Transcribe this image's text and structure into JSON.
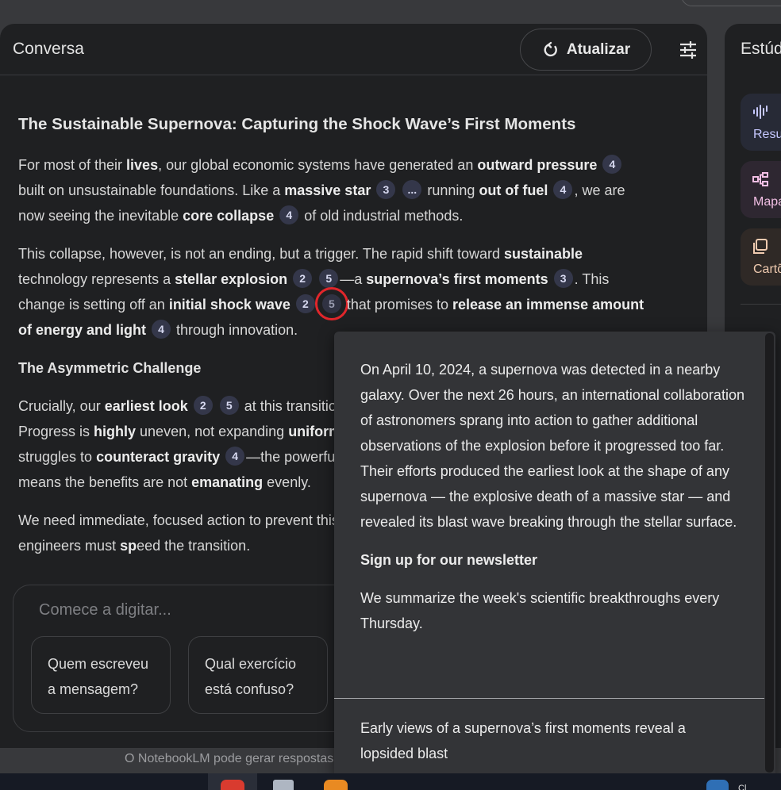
{
  "chat": {
    "title": "Conversa",
    "refresh_label": "Atualizar",
    "heading": "The Sustainable Supernova: Capturing the Shock Wave’s First Moments",
    "subhead": "The Asymmetric Challenge",
    "input_placeholder": "Comece a digitar...",
    "suggestions": [
      "Quem escreveu a mensagem?",
      "Qual exercício está confuso?"
    ],
    "footer_note": "O NotebookLM pode gerar respostas"
  },
  "studio": {
    "title": "Estúdio",
    "tiles": [
      {
        "label": "Resumo",
        "color": "#c6c8ff",
        "bg": "#272a36"
      },
      {
        "label": "Mapa mental",
        "color": "#f2bfe4",
        "bg": "#2e2731"
      },
      {
        "label": "Cartões",
        "color": "#f0cbb0",
        "bg": "#2f2926"
      }
    ]
  },
  "popover": {
    "paragraph": "On April 10, 2024, a supernova was detected in a nearby galaxy. Over the next 26 hours, an international collaboration of astronomers sprang into action to gather additional observations of the explosion before it progressed too far. Their efforts produced the earliest look at the shape of any supernova — the explosive death of a massive star — and revealed its blast wave breaking through the stellar surface.",
    "newsletter": "Sign up for our newsletter",
    "newsletter_desc": "We summarize the week's scientific breakthroughs every Thursday.",
    "source_title": "Early views of a supernova’s first moments reveal a lopsided blast"
  },
  "taskbar": {
    "clock_text": "Cl"
  }
}
